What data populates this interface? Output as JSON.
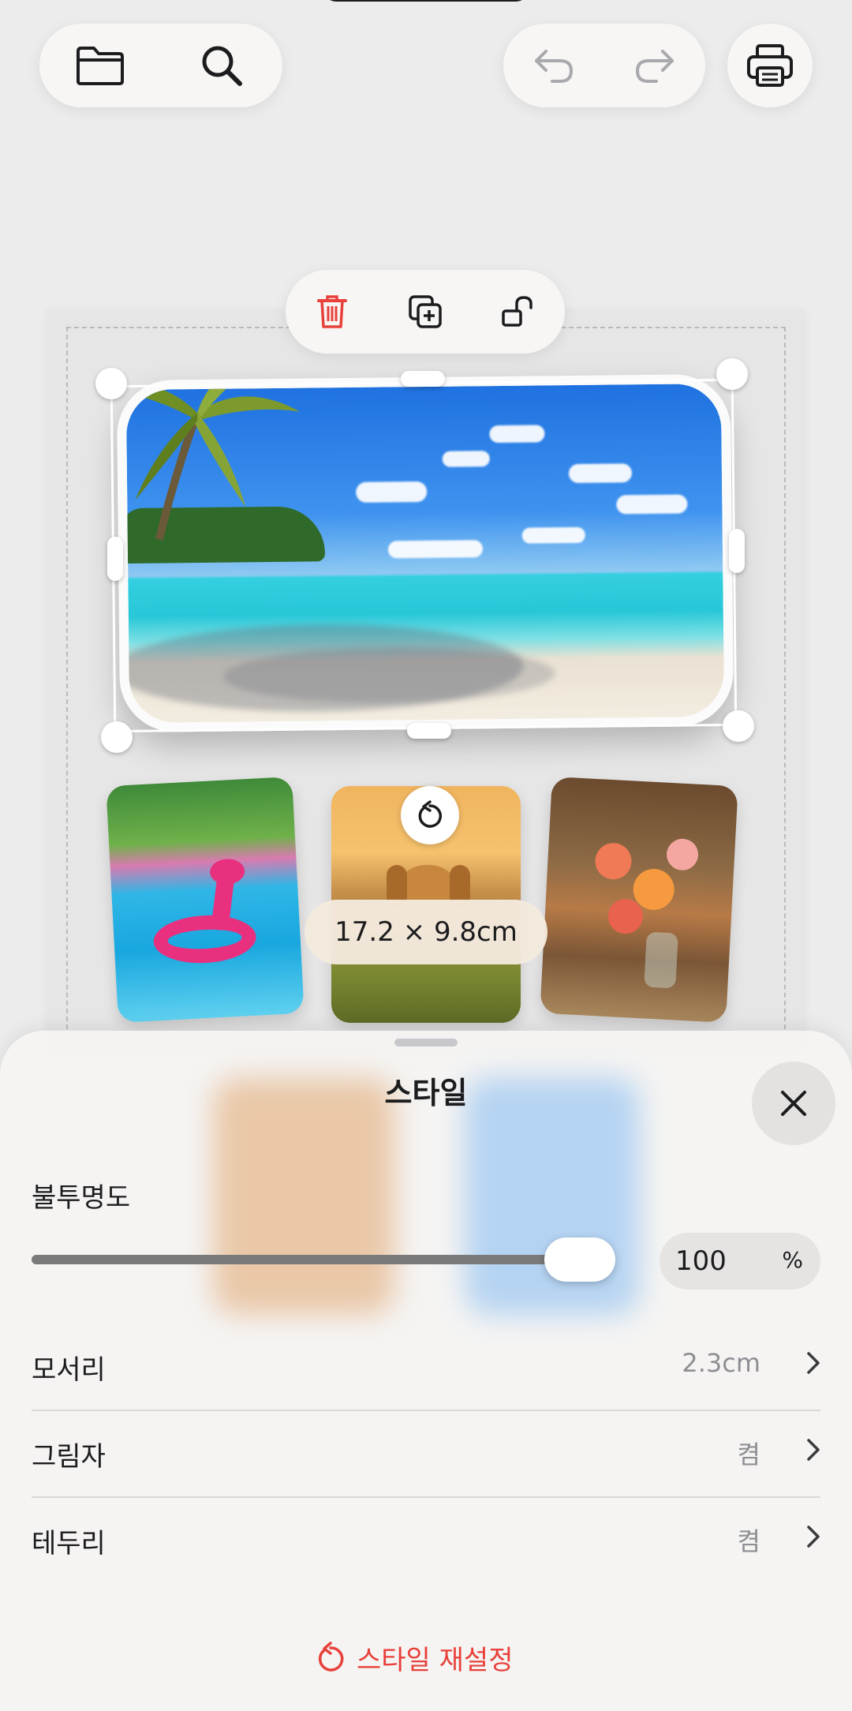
{
  "top_bar": {
    "folder_icon": "folder-icon",
    "search_icon": "search-icon",
    "undo_icon": "undo-icon",
    "redo_icon": "redo-icon",
    "print_icon": "printer-icon"
  },
  "context_toolbar": {
    "delete_icon": "trash-icon",
    "duplicate_icon": "duplicate-icon",
    "lock_icon": "unlock-icon",
    "accent_color": "#e8403a"
  },
  "selection": {
    "size_label": "17.2 × 9.8cm"
  },
  "style_sheet": {
    "title": "스타일",
    "opacity": {
      "label": "불투명도",
      "value": "100",
      "unit": "%",
      "fraction": 1.0
    },
    "rows": [
      {
        "label": "모서리",
        "value": "2.3cm"
      },
      {
        "label": "그림자",
        "value": "켬"
      },
      {
        "label": "테두리",
        "value": "켬"
      }
    ],
    "reset_label": "스타일 재설정",
    "reset_color": "#e8403a"
  }
}
